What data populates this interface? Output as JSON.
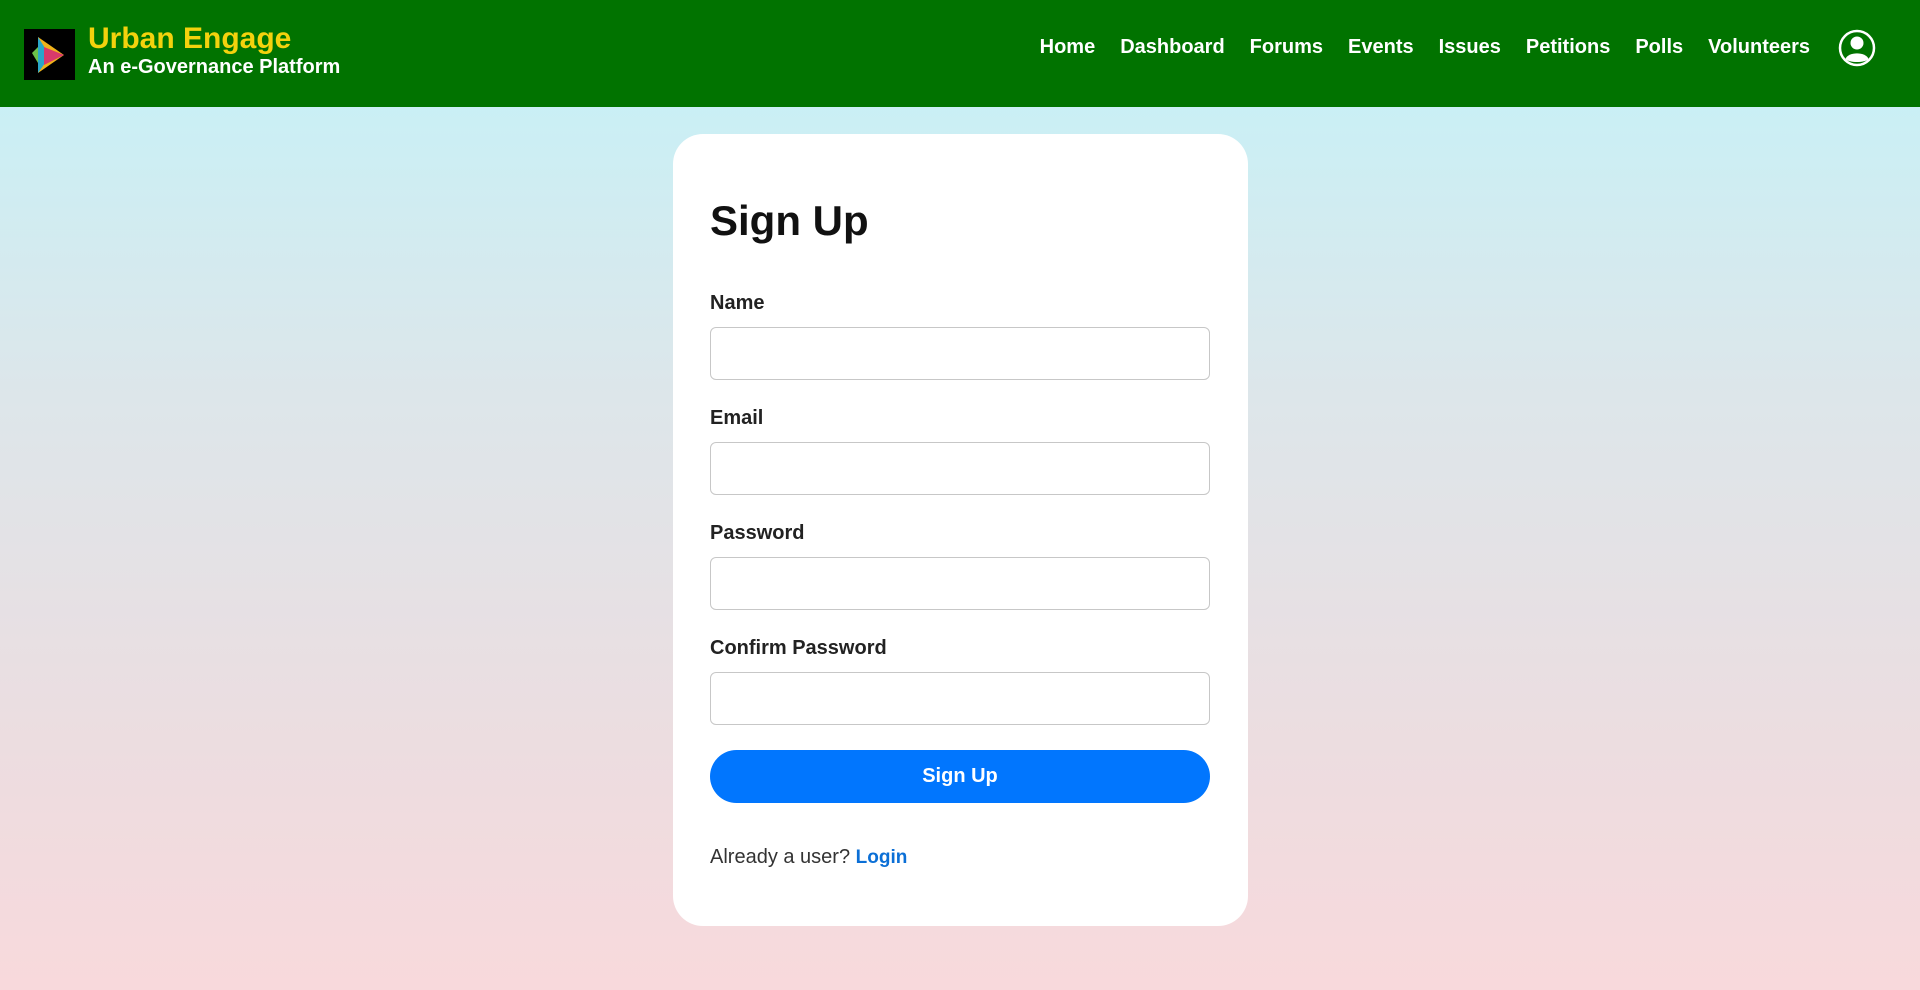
{
  "colors": {
    "navbar_bg": "#017300",
    "brand_title": "#f3d20d",
    "primary_button": "#0176fe",
    "link": "#0b6fd6"
  },
  "brand": {
    "logo_icon": "play-logo-icon",
    "title": "Urban Engage",
    "subtitle": "An e-Governance Platform"
  },
  "nav": {
    "items": [
      {
        "label": "Home"
      },
      {
        "label": "Dashboard"
      },
      {
        "label": "Forums"
      },
      {
        "label": "Events"
      },
      {
        "label": "Issues"
      },
      {
        "label": "Petitions"
      },
      {
        "label": "Polls"
      },
      {
        "label": "Volunteers"
      }
    ],
    "profile_icon": "user-circle-icon"
  },
  "form": {
    "title": "Sign Up",
    "fields": [
      {
        "label": "Name",
        "value": "",
        "placeholder": ""
      },
      {
        "label": "Email",
        "value": "",
        "placeholder": ""
      },
      {
        "label": "Password",
        "value": "",
        "placeholder": ""
      },
      {
        "label": "Confirm Password",
        "value": "",
        "placeholder": ""
      }
    ],
    "submit_label": "Sign Up",
    "footer_text": "Already a user?",
    "login_label": "Login"
  }
}
